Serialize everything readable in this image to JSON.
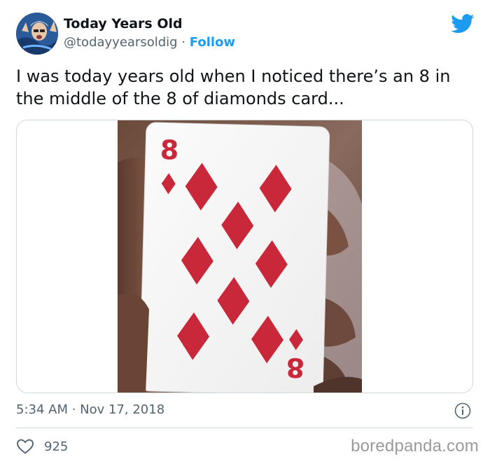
{
  "author": {
    "display_name": "Today Years Old",
    "handle": "@todayyearsoldig",
    "separator": "·",
    "follow_label": "Follow"
  },
  "tweet": {
    "text": "I was today years old when I noticed there’s an 8 in the middle of the 8 of diamonds card...",
    "timestamp": "5:34 AM · Nov 17, 2018"
  },
  "card": {
    "rank": "8",
    "suit_icon": "diamond-icon"
  },
  "engagement": {
    "like_count": "925"
  },
  "watermark": "boredpanda.com",
  "colors": {
    "accent": "#1d9bf0",
    "text_primary": "#0f1419",
    "text_secondary": "#536471",
    "card_red": "#c8283a",
    "border": "#cfd9de"
  }
}
